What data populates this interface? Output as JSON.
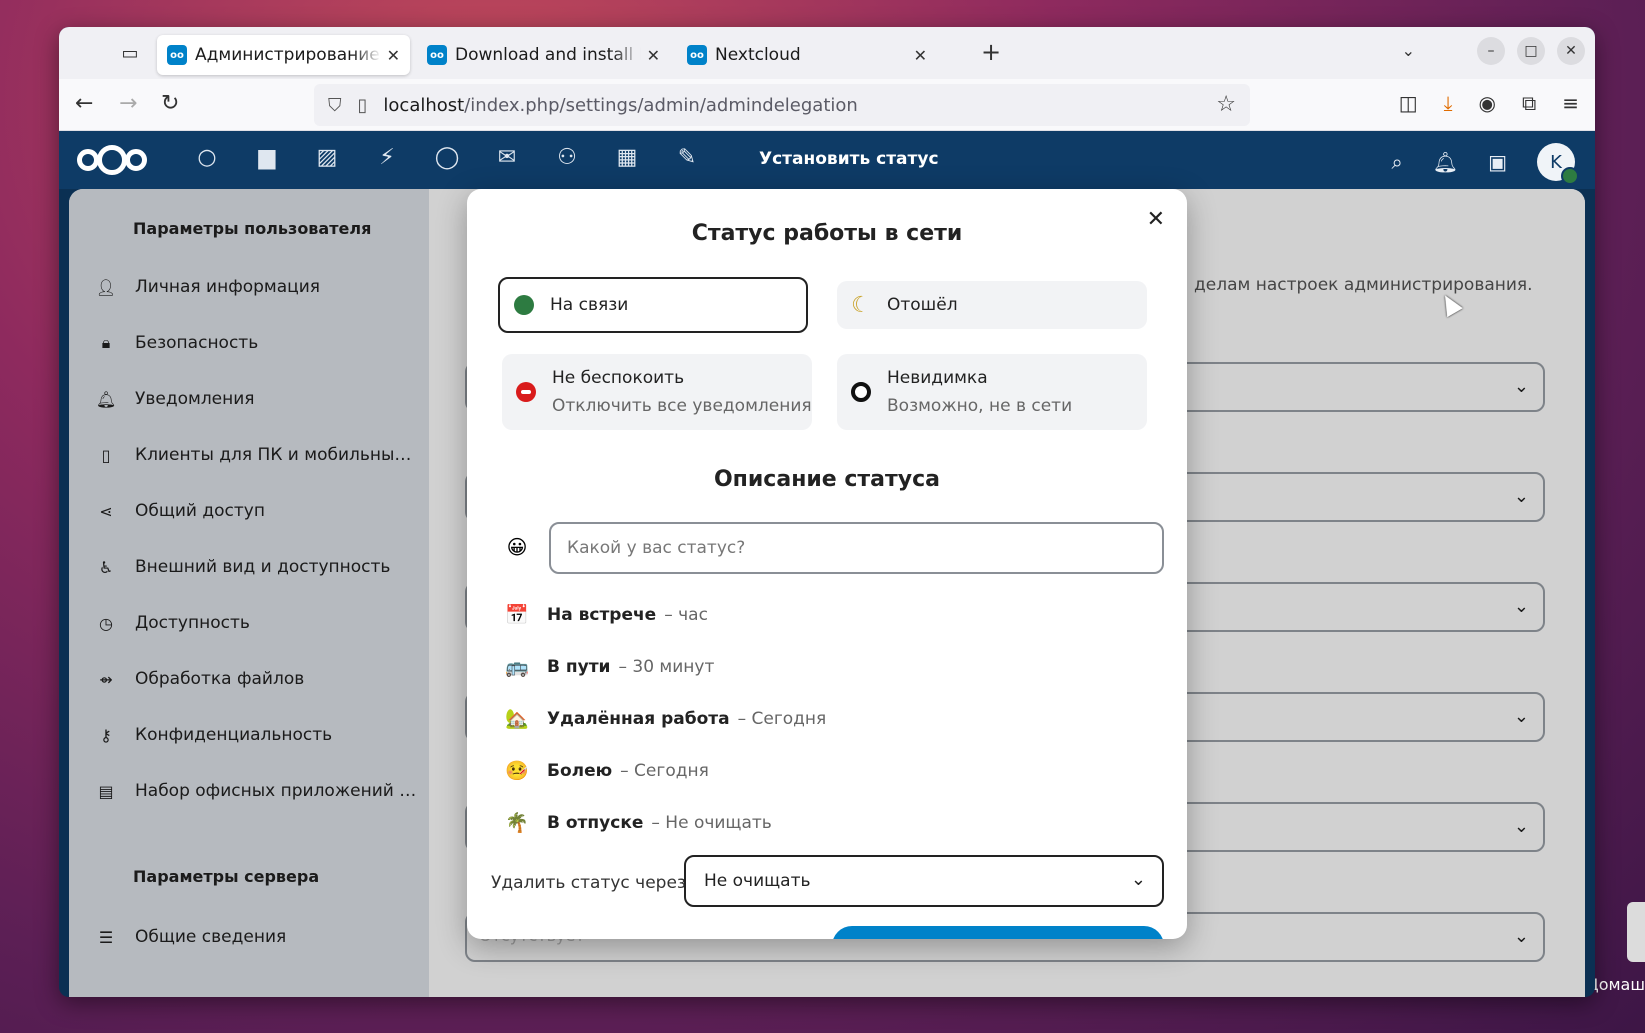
{
  "desktop": {
    "label": "Домаш"
  },
  "browser": {
    "tabs": [
      {
        "title": "Администрирование - Пер",
        "icon": "nextcloud-icon"
      },
      {
        "title": "Download and install Nextcloud",
        "icon": "nextcloud-icon"
      },
      {
        "title": "Nextcloud",
        "icon": "nextcloud-icon"
      }
    ],
    "url_host": "localhost",
    "url_path": "/index.php/settings/admin/admindelegation"
  },
  "header": {
    "title": "Установить статус"
  },
  "avatar_initial": "K",
  "sidebar": {
    "user_caption": "Параметры пользователя",
    "user_items": [
      {
        "label": "Личная информация",
        "icon": "person-icon"
      },
      {
        "label": "Безопасность",
        "icon": "lock-icon"
      },
      {
        "label": "Уведомления",
        "icon": "bell-icon"
      },
      {
        "label": "Клиенты для ПК и мобильны…",
        "icon": "phone-icon"
      },
      {
        "label": "Общий доступ",
        "icon": "share-icon"
      },
      {
        "label": "Внешний вид и доступность",
        "icon": "accessibility-icon"
      },
      {
        "label": "Доступность",
        "icon": "clock-icon"
      },
      {
        "label": "Обработка файлов",
        "icon": "file-processing-icon"
      },
      {
        "label": "Конфиденциальность",
        "icon": "key-icon"
      },
      {
        "label": "Набор офисных приложений …",
        "icon": "document-icon"
      }
    ],
    "server_caption": "Параметры сервера",
    "server_items": [
      {
        "label": "Общие сведения",
        "icon": "list-icon"
      }
    ]
  },
  "background": {
    "description_fragment": "делам настроек администрирования.",
    "last_placeholder": "Отсутствует"
  },
  "modal": {
    "title": "Статус работы в сети",
    "statuses": {
      "online": {
        "label": "На связи",
        "selected": true
      },
      "away": {
        "label": "Отошёл"
      },
      "dnd": {
        "label": "Не беспокоить",
        "sub": "Отключить все уведомления"
      },
      "invisible": {
        "label": "Невидимка",
        "sub": "Возможно, не в сети"
      }
    },
    "message_title": "Описание статуса",
    "message_placeholder": "Какой у вас статус?",
    "message_emoji": "😀",
    "predefined": [
      {
        "emoji": "📅",
        "message": "На встрече",
        "clear": "– час"
      },
      {
        "emoji": "🚌",
        "message": "В пути",
        "clear": "– 30 минут"
      },
      {
        "emoji": "🏡",
        "message": "Удалённая работа",
        "clear": "– Сегодня"
      },
      {
        "emoji": "🤒",
        "message": "Болею",
        "clear": "– Сегодня"
      },
      {
        "emoji": "🌴",
        "message": "В отпуске",
        "clear": "– Не очищать"
      }
    ],
    "clear_label": "Удалить статус через",
    "clear_value": "Не очищать"
  },
  "colors": {
    "nc_blue": "#0e3b66",
    "accent": "#0082c9",
    "online": "#2d7b41",
    "dnd": "#d91b1b"
  }
}
